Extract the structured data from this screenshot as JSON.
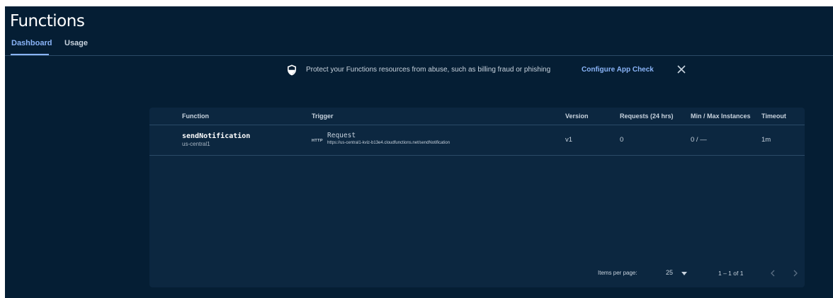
{
  "page": {
    "title": "Functions"
  },
  "tabs": [
    {
      "label": "Dashboard",
      "active": true
    },
    {
      "label": "Usage",
      "active": false
    }
  ],
  "banner": {
    "icon": "shield-icon",
    "message": "Protect your Functions resources from abuse, such as billing fraud or phishing",
    "link": "Configure App Check",
    "close_icon": "close-icon"
  },
  "table": {
    "columns": [
      "Function",
      "Trigger",
      "Version",
      "Requests (24 hrs)",
      "Min / Max Instances",
      "Timeout"
    ],
    "rows": [
      {
        "function": "sendNotification",
        "region": "us-central1",
        "trigger_badge": "HTTP",
        "trigger_type": "Request",
        "trigger_url": "https://us-central1-kviz-b13e4.cloudfunctions.net/sendNotification",
        "version": "v1",
        "requests": "0",
        "instances": "0 / —",
        "timeout": "1m"
      }
    ]
  },
  "pagination": {
    "items_per_page_label": "Items per page:",
    "items_per_page": "25",
    "range": "1 – 1 of 1",
    "prev_icon": "chevron-left-icon",
    "next_icon": "chevron-right-icon"
  },
  "colors": {
    "background": "#051e34",
    "card": "#0c2740",
    "accent": "#8ab4f8",
    "text": "#c8d3de"
  }
}
